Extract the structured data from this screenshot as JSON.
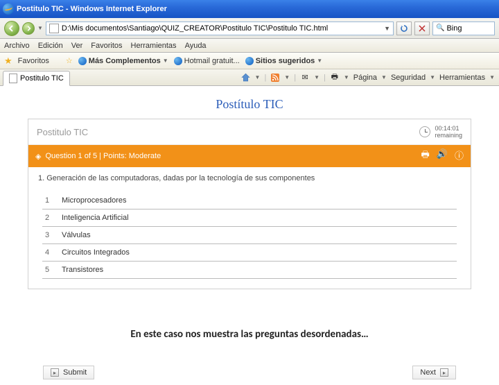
{
  "window": {
    "title": "Postitulo TIC - Windows Internet Explorer"
  },
  "address": {
    "path": "D:\\Mis documentos\\Santiago\\QUIZ_CREATOR\\Postitulo TIC\\Postitulo TIC.html"
  },
  "search": {
    "engine": "Bing"
  },
  "menu": {
    "archivo": "Archivo",
    "edicion": "Edición",
    "ver": "Ver",
    "favoritos": "Favoritos",
    "herramientas": "Herramientas",
    "ayuda": "Ayuda"
  },
  "favbar": {
    "favoritos": "Favoritos",
    "mas": "Más Complementos",
    "hotmail": "Hotmail gratuit...",
    "sugeridos": "Sitios sugeridos"
  },
  "tab": {
    "label": "Postitulo TIC"
  },
  "toolbar": {
    "pagina": "Página",
    "seguridad": "Seguridad",
    "herramientas": "Herramientas"
  },
  "quiz": {
    "title": "Postítulo TIC",
    "subtitle": "Postitulo TIC",
    "timer_time": "00:14:01",
    "timer_label": "remaining",
    "bar_text": "Question 1 of 5 | Points: Moderate",
    "question": "1.  Generación de las computadoras, dadas por la tecnología de sus componentes",
    "answers": [
      {
        "n": "1",
        "t": "Microprocesadores"
      },
      {
        "n": "2",
        "t": "Inteligencia Artificial"
      },
      {
        "n": "3",
        "t": "Válvulas"
      },
      {
        "n": "4",
        "t": "Circuitos Integrados"
      },
      {
        "n": "5",
        "t": "Transistores"
      }
    ],
    "submit": "Submit",
    "next": "Next"
  },
  "caption": "En este caso nos muestra las preguntas desordenadas…"
}
